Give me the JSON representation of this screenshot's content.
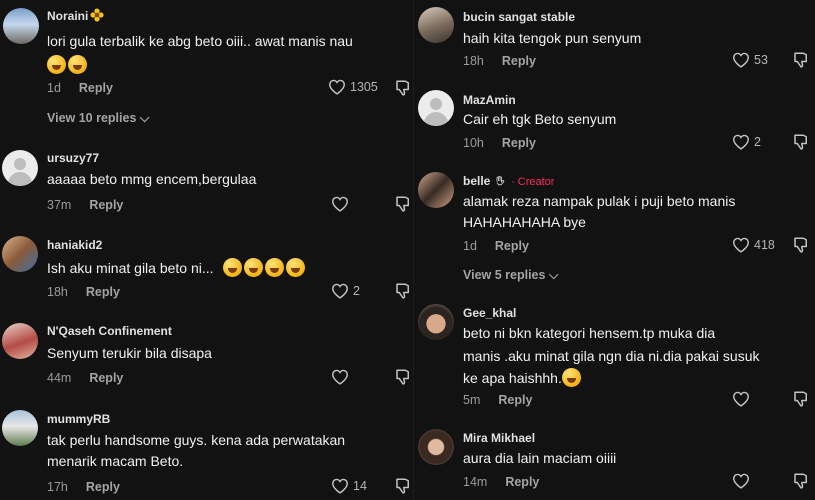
{
  "left_comments": [
    {
      "username": "Noraini",
      "flair": "flower-icon",
      "text_lines": [
        "lori gula terbalik ke abg beto oiii.. awat manis nau"
      ],
      "emoji_line_count": 2,
      "time": "1d",
      "reply_label": "Reply",
      "likes": "1305",
      "view_replies": "View 10 replies"
    },
    {
      "username": "ursuzy77",
      "text_lines": [
        "aaaaa beto mmg encem,bergulaa"
      ],
      "time": "37m",
      "reply_label": "Reply",
      "likes": ""
    },
    {
      "username": "haniakid2",
      "text_lines": [
        "Ish aku minat gila beto ni..."
      ],
      "emoji_inline_count": 4,
      "time": "18h",
      "reply_label": "Reply",
      "likes": "2"
    },
    {
      "username": "N'Qaseh Confinement",
      "text_lines": [
        "Senyum terukir bila disapa"
      ],
      "time": "44m",
      "reply_label": "Reply",
      "likes": ""
    },
    {
      "username": "mummyRB",
      "text_lines": [
        "tak perlu handsome guys. kena ada perwatakan",
        "menarik macam Beto."
      ],
      "time": "17h",
      "reply_label": "Reply",
      "likes": "14"
    }
  ],
  "right_comments": [
    {
      "username": "bucin sangat stable",
      "text_lines": [
        "haih kita tengok pun senyum"
      ],
      "time": "18h",
      "reply_label": "Reply",
      "likes": "53"
    },
    {
      "username": "MazAmin",
      "text_lines": [
        "Cair eh tgk Beto senyum"
      ],
      "time": "10h",
      "reply_label": "Reply",
      "likes": "2"
    },
    {
      "username": "belle",
      "creator_label": "· Creator",
      "text_lines": [
        "alamak reza nampak pulak i puji beto manis",
        "HAHAHAHAHA bye"
      ],
      "time": "1d",
      "reply_label": "Reply",
      "likes": "418",
      "view_replies": "View 5 replies"
    },
    {
      "username": "Gee_khal",
      "text_lines": [
        "beto ni bkn kategori hensem.tp muka dia",
        "manis .aku minat gila ngn dia ni.dia pakai susuk",
        "ke apa haishhh."
      ],
      "emoji_inline_count": 1,
      "time": "5m",
      "reply_label": "Reply",
      "likes": ""
    },
    {
      "username": "Mira Mikhael",
      "text_lines": [
        "aura dia lain maciam oiiii"
      ],
      "time": "14m",
      "reply_label": "Reply",
      "likes": ""
    }
  ],
  "colors": {
    "background": "#121212",
    "text": "#f1f1f2",
    "meta": "#9b9b9d",
    "creator": "#fe2c55"
  }
}
